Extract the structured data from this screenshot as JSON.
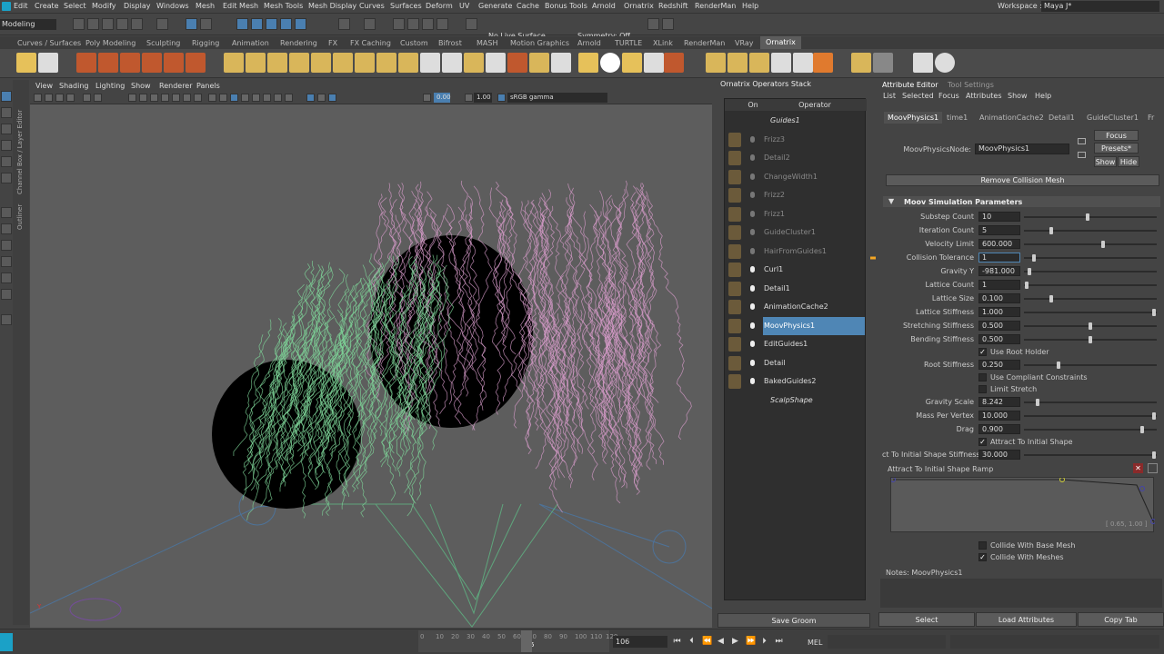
{
  "menubar": {
    "items": [
      "Edit",
      "Create",
      "Select",
      "Modify",
      "Display",
      "Windows",
      "Mesh",
      "Edit Mesh",
      "Mesh Tools",
      "Mesh Display",
      "Curves",
      "Surfaces",
      "Deform",
      "UV",
      "Generate",
      "Cache",
      "Bonus Tools",
      "Arnold",
      "Ornatrix",
      "Redshift",
      "RenderMan",
      "Help"
    ],
    "workspace_label": "Workspace :",
    "workspace_value": "Maya J*"
  },
  "statusline": {
    "mode": "Modeling",
    "live_surface": "No Live Surface",
    "symmetry": "Symmetry: Off"
  },
  "shelf_tabs": [
    "Curves / Surfaces",
    "Poly Modeling",
    "Sculpting",
    "Rigging",
    "Animation",
    "Rendering",
    "FX",
    "FX Caching",
    "Custom",
    "Bifrost",
    "MASH",
    "Motion Graphics",
    "Arnold",
    "TURTLE",
    "XLink",
    "RenderMan",
    "VRay",
    "Ornatrix"
  ],
  "side_tabs": [
    "Channel Box / Layer Editor",
    "Outliner"
  ],
  "viewport": {
    "menu": [
      "View",
      "Shading",
      "Lighting",
      "Show",
      "Renderer",
      "Panels"
    ],
    "field1": "0.00",
    "field2": "1.00",
    "colorspace": "sRGB gamma"
  },
  "operators": {
    "title": "Ornatrix Operators Stack",
    "col_on": "On",
    "col_operator": "Operator",
    "rows": [
      {
        "name": "Guides1",
        "state": "ital"
      },
      {
        "name": "Frizz3",
        "state": "dim"
      },
      {
        "name": "Detail2",
        "state": "dim"
      },
      {
        "name": "ChangeWidth1",
        "state": "dim"
      },
      {
        "name": "Frizz2",
        "state": "dim"
      },
      {
        "name": "Frizz1",
        "state": "dim"
      },
      {
        "name": "GuideCluster1",
        "state": "dim"
      },
      {
        "name": "HairFromGuides1",
        "state": "dim"
      },
      {
        "name": "Curl1",
        "state": "on"
      },
      {
        "name": "Detail1",
        "state": "on"
      },
      {
        "name": "AnimationCache2",
        "state": "on"
      },
      {
        "name": "MoovPhysics1",
        "state": "sel"
      },
      {
        "name": "EditGuides1",
        "state": "on"
      },
      {
        "name": "Detail",
        "state": "on"
      },
      {
        "name": "BakedGuides2",
        "state": "on"
      },
      {
        "name": "ScalpShape",
        "state": "ital"
      }
    ],
    "save_button": "Save Groom"
  },
  "attribute_editor": {
    "tabs": [
      "Attribute Editor",
      "Tool Settings"
    ],
    "menu": [
      "List",
      "Selected",
      "Focus",
      "Attributes",
      "Show",
      "Help"
    ],
    "node_tabs": [
      "MoovPhysics1",
      "time1",
      "AnimationCache2",
      "Detail1",
      "GuideCluster1",
      "Fr"
    ],
    "node_label": "MoovPhysicsNode:",
    "node_value": "MoovPhysics1",
    "focus_btn": "Focus",
    "presets_btn": "Presets*",
    "show_btn": "Show",
    "hide_btn": "Hide",
    "remove_btn": "Remove Collision Mesh",
    "section": "Moov Simulation Parameters",
    "params": [
      {
        "label": "Substep Count",
        "value": "10",
        "pos": 0.48
      },
      {
        "label": "Iteration Count",
        "value": "5",
        "pos": 0.2
      },
      {
        "label": "Velocity Limit",
        "value": "600.000",
        "pos": 0.6
      },
      {
        "label": "Collision Tolerance",
        "value": "1",
        "pos": 0.06
      },
      {
        "label": "Gravity Y",
        "value": "-981.000",
        "pos": 0.03
      },
      {
        "label": "Lattice Count",
        "value": "1",
        "pos": 0.01
      },
      {
        "label": "Lattice Size",
        "value": "0.100",
        "pos": 0.2
      },
      {
        "label": "Lattice Stiffness",
        "value": "1.000",
        "pos": 0.99
      },
      {
        "label": "Stretching Stiffness",
        "value": "0.500",
        "pos": 0.5
      },
      {
        "label": "Bending Stiffness",
        "value": "0.500",
        "pos": 0.5
      }
    ],
    "use_root_holder": "Use Root Holder",
    "root_stiffness": {
      "label": "Root Stiffness",
      "value": "0.250",
      "pos": 0.25
    },
    "use_compliant": "Use Compliant Constraints",
    "limit_stretch": "Limit Stretch",
    "params2": [
      {
        "label": "Gravity Scale",
        "value": "8.242",
        "pos": 0.09
      },
      {
        "label": "Mass Per Vertex",
        "value": "10.000",
        "pos": 0.99
      },
      {
        "label": "Drag",
        "value": "0.900",
        "pos": 0.9
      }
    ],
    "attract_initial": "Attract To Initial Shape",
    "attract_stiffness": {
      "label": "ct To Initial Shape Stiffness",
      "value": "30.000",
      "pos": 0.99
    },
    "ramp_label": "Attract To Initial Shape Ramp",
    "ramp_value": "[ 0.65, 1.00 ]",
    "collide_base": "Collide With Base Mesh",
    "collide_meshes": "Collide With Meshes",
    "notes": "Notes:  MoovPhysics1",
    "footer": [
      "Select",
      "Load Attributes",
      "Copy Tab"
    ]
  },
  "timeline": {
    "ticks": [
      "0",
      "10",
      "20",
      "30",
      "40",
      "50",
      "60",
      "70",
      "80",
      "90",
      "100",
      "106",
      "110",
      "120"
    ],
    "current": "106",
    "frame_field": "106",
    "mel": "MEL"
  },
  "colors": {
    "accent": "#f5a623",
    "selection": "#4f86b5",
    "hair_pink": "#d79bc9",
    "hair_green": "#7fd79a"
  }
}
